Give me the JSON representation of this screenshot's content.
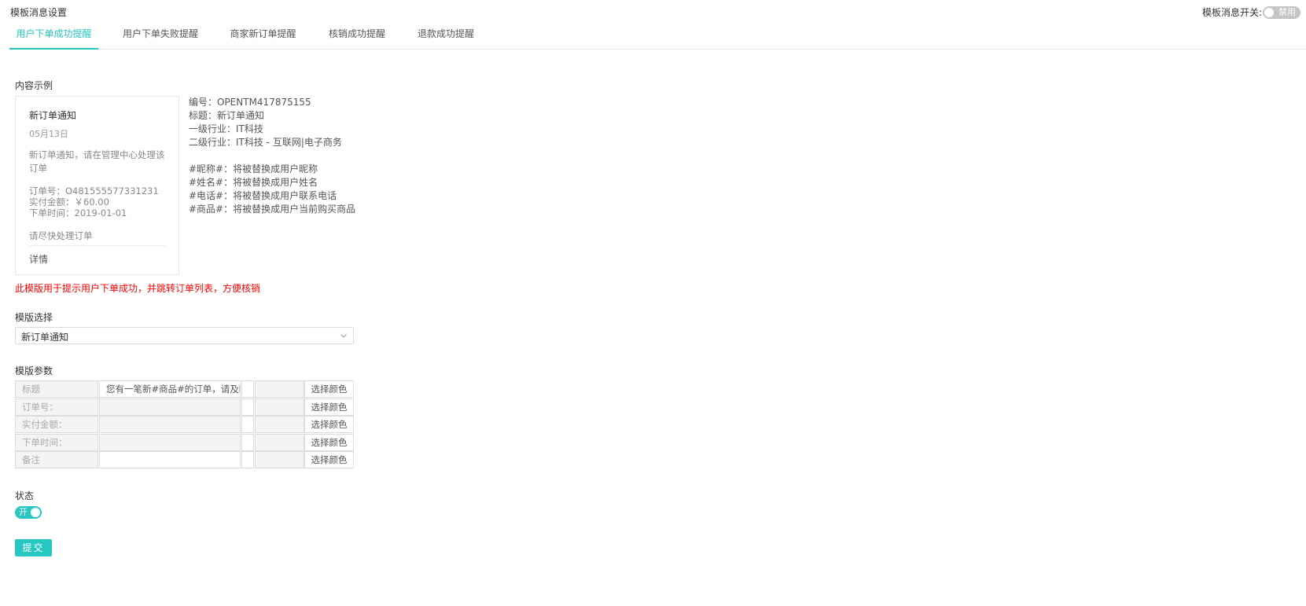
{
  "page_title": "模板消息设置",
  "global_switch": {
    "label": "模板消息开关:",
    "state_text": "禁用"
  },
  "tabs": [
    {
      "label": "用户下单成功提醒",
      "active": true
    },
    {
      "label": "用户下单失败提醒",
      "active": false
    },
    {
      "label": "商家新订单提醒",
      "active": false
    },
    {
      "label": "核销成功提醒",
      "active": false
    },
    {
      "label": "退款成功提醒",
      "active": false
    }
  ],
  "preview": {
    "section_label": "内容示例",
    "card": {
      "title": "新订单通知",
      "date": "05月13日",
      "body": "新订单通知，请在管理中心处理该订单",
      "order_no": "订单号：O481555577331231",
      "amount": "实付金额：￥60.00",
      "order_time": "下单时间：2019-01-01",
      "remark": "请尽快处理订单",
      "detail_link": "详情"
    },
    "info": {
      "number": "编号：OPENTM417875155",
      "title": "标题：新订单通知",
      "industry_1": "一级行业：IT科技",
      "industry_2": "二级行业：IT科技 - 互联网|电子商务",
      "var_nickname": "#昵称#：将被替换成用户昵称",
      "var_name": "#姓名#：将被替换成用户姓名",
      "var_phone": "#电话#：将被替换成用户联系电话",
      "var_goods": "#商品#：将被替换成用户当前购买商品"
    }
  },
  "warning": "此模版用于提示用户下单成功，并跳转订单列表，方便核销",
  "template_select": {
    "label": "模版选择",
    "value": "新订单通知",
    "icon": "chevron-down-icon"
  },
  "params": {
    "label": "模版参数",
    "rows": [
      {
        "label": "标题",
        "value": "您有一笔新#商品#的订单，请及时处理",
        "editable": true,
        "button": "选择颜色"
      },
      {
        "label": "订单号：",
        "value": "",
        "editable": false,
        "button": "选择颜色"
      },
      {
        "label": "实付金额：",
        "value": "",
        "editable": false,
        "button": "选择颜色"
      },
      {
        "label": "下单时间：",
        "value": "",
        "editable": false,
        "button": "选择颜色"
      },
      {
        "label": "备注",
        "value": "",
        "editable": true,
        "button": "选择颜色"
      }
    ]
  },
  "status": {
    "label": "状态",
    "toggle_text": "开",
    "on": true
  },
  "submit_label": "提交",
  "colors": {
    "accent": "#26c6c1",
    "warning": "#ff0000",
    "toggle_off": "#c5c5c5"
  }
}
